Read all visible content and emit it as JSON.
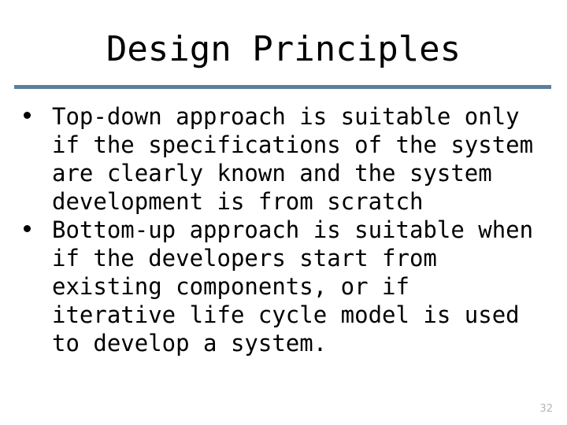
{
  "slide": {
    "title": "Design Principles",
    "accent_color": "#5b7f9e",
    "text_color": "#000000",
    "background_color": "#ffffff",
    "page_number": "32",
    "page_number_color": "#b5b5b5",
    "bullets": [
      {
        "marker": "bullet-dot",
        "text": "Top-down approach is suitable only if the specifications of the system are clearly known and the system development is from scratch",
        "lines": [
          "Top-down approach is suitable only",
          "if the specifications of the system",
          "are clearly known and the system",
          "development is from scratch"
        ]
      },
      {
        "marker": "bullet-dot",
        "text": "Bottom-up approach is suitable when if the developers start from existing components, or if iterative life cycle model is used to develop a system.",
        "lines": [
          "Bottom-up approach is suitable when",
          "if the developers start from",
          "existing components, or if",
          "iterative life cycle model is used",
          "to develop a system."
        ]
      }
    ]
  }
}
